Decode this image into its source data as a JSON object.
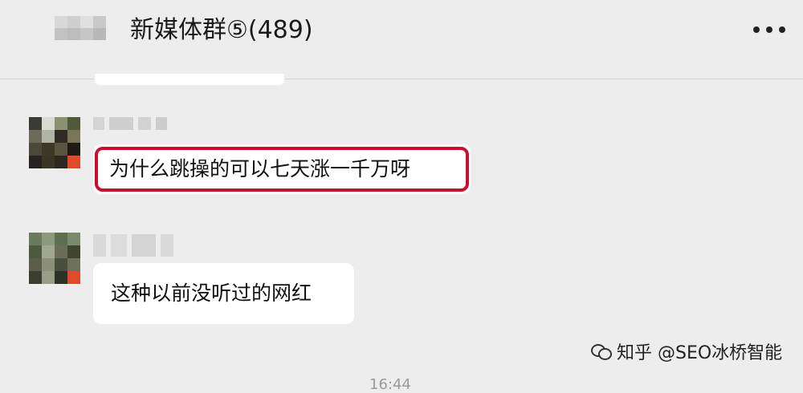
{
  "header": {
    "title": "新媒体群⑤(489)",
    "more_icon": "more-icon"
  },
  "messages": [
    {
      "sender_blurred": true,
      "text": "为什么跳操的可以七天涨一千万呀",
      "highlight_color": "#c8102e"
    },
    {
      "sender_blurred": true,
      "text": "这种以前没听过的网红"
    }
  ],
  "watermark": {
    "icon": "wechat-icon",
    "text": "知乎 @SEO冰桥智能"
  },
  "timestamp": "16:44",
  "colors": {
    "background": "#ededed",
    "bubble": "#ffffff",
    "highlight": "#c8102e"
  }
}
